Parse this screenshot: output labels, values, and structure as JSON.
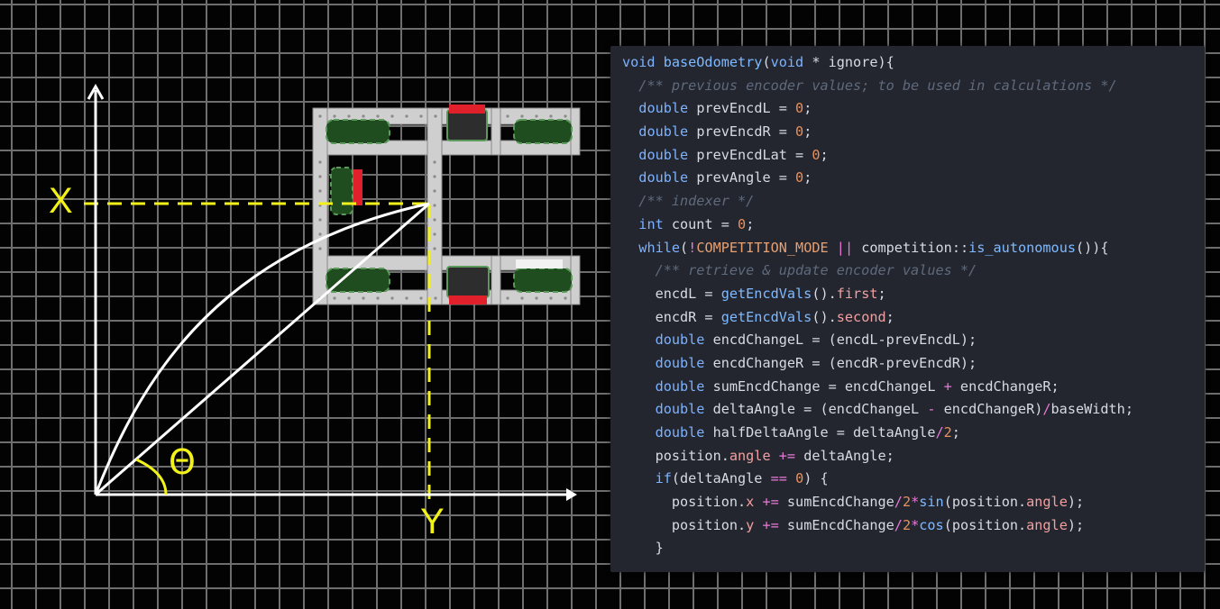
{
  "diagram": {
    "label_x": "X",
    "label_y": "Y",
    "label_theta": "Θ",
    "colors": {
      "axes": "#ffffff",
      "guides": "#f2f21a",
      "robot_frame": "#c9c9c9",
      "wheel": "#2f6a2f",
      "accent": "#e0202a"
    }
  },
  "code": {
    "lines": [
      [
        [
          "kw",
          "void "
        ],
        [
          "fn",
          "baseOdometry"
        ],
        [
          "plain",
          "("
        ],
        [
          "kw",
          "void"
        ],
        [
          "plain",
          " * ignore){"
        ]
      ],
      [
        [
          "plain",
          "  "
        ],
        [
          "cm",
          "/** previous encoder values; to be used in calculations */"
        ]
      ],
      [
        [
          "plain",
          "  "
        ],
        [
          "kw",
          "double "
        ],
        [
          "plain",
          "prevEncdL = "
        ],
        [
          "num",
          "0"
        ],
        [
          "plain",
          ";"
        ]
      ],
      [
        [
          "plain",
          "  "
        ],
        [
          "kw",
          "double "
        ],
        [
          "plain",
          "prevEncdR = "
        ],
        [
          "num",
          "0"
        ],
        [
          "plain",
          ";"
        ]
      ],
      [
        [
          "plain",
          "  "
        ],
        [
          "kw",
          "double "
        ],
        [
          "plain",
          "prevEncdLat = "
        ],
        [
          "num",
          "0"
        ],
        [
          "plain",
          ";"
        ]
      ],
      [
        [
          "plain",
          "  "
        ],
        [
          "kw",
          "double "
        ],
        [
          "plain",
          "prevAngle = "
        ],
        [
          "num",
          "0"
        ],
        [
          "plain",
          ";"
        ]
      ],
      [
        [
          "plain",
          "  "
        ],
        [
          "cm",
          "/** indexer */"
        ]
      ],
      [
        [
          "plain",
          "  "
        ],
        [
          "kw",
          "int "
        ],
        [
          "plain",
          "count = "
        ],
        [
          "num",
          "0"
        ],
        [
          "plain",
          ";"
        ]
      ],
      [
        [
          "plain",
          "  "
        ],
        [
          "kw",
          "while"
        ],
        [
          "plain",
          "("
        ],
        [
          "op",
          "!"
        ],
        [
          "macro",
          "COMPETITION_MODE"
        ],
        [
          "plain",
          " "
        ],
        [
          "op",
          "||"
        ],
        [
          "plain",
          " competition::"
        ],
        [
          "fn",
          "is_autonomous"
        ],
        [
          "plain",
          "()){"
        ]
      ],
      [
        [
          "plain",
          "    "
        ],
        [
          "cm",
          "/** retrieve & update encoder values */"
        ]
      ],
      [
        [
          "plain",
          "    encdL = "
        ],
        [
          "fn",
          "getEncdVals"
        ],
        [
          "plain",
          "()."
        ],
        [
          "prop",
          "first"
        ],
        [
          "plain",
          ";"
        ]
      ],
      [
        [
          "plain",
          "    encdR = "
        ],
        [
          "fn",
          "getEncdVals"
        ],
        [
          "plain",
          "()."
        ],
        [
          "prop",
          "second"
        ],
        [
          "plain",
          ";"
        ]
      ],
      [
        [
          "plain",
          "    "
        ],
        [
          "kw",
          "double "
        ],
        [
          "plain",
          "encdChangeL = (encdL-prevEncdL);"
        ]
      ],
      [
        [
          "plain",
          "    "
        ],
        [
          "kw",
          "double "
        ],
        [
          "plain",
          "encdChangeR = (encdR-prevEncdR);"
        ]
      ],
      [
        [
          "plain",
          "    "
        ],
        [
          "kw",
          "double "
        ],
        [
          "plain",
          "sumEncdChange = encdChangeL "
        ],
        [
          "op",
          "+"
        ],
        [
          "plain",
          " encdChangeR;"
        ]
      ],
      [
        [
          "plain",
          "    "
        ],
        [
          "kw",
          "double "
        ],
        [
          "plain",
          "deltaAngle = (encdChangeL "
        ],
        [
          "op",
          "-"
        ],
        [
          "plain",
          " encdChangeR)"
        ],
        [
          "op",
          "/"
        ],
        [
          "plain",
          "baseWidth;"
        ]
      ],
      [
        [
          "plain",
          "    "
        ],
        [
          "kw",
          "double "
        ],
        [
          "plain",
          "halfDeltaAngle = deltaAngle"
        ],
        [
          "op",
          "/"
        ],
        [
          "num",
          "2"
        ],
        [
          "plain",
          ";"
        ]
      ],
      [
        [
          "plain",
          "    position."
        ],
        [
          "prop",
          "angle"
        ],
        [
          "plain",
          " "
        ],
        [
          "op",
          "+="
        ],
        [
          "plain",
          " deltaAngle;"
        ]
      ],
      [
        [
          "plain",
          "    "
        ],
        [
          "kw",
          "if"
        ],
        [
          "plain",
          "(deltaAngle "
        ],
        [
          "op",
          "=="
        ],
        [
          "plain",
          " "
        ],
        [
          "num",
          "0"
        ],
        [
          "plain",
          ") {"
        ]
      ],
      [
        [
          "plain",
          "      position."
        ],
        [
          "prop",
          "x"
        ],
        [
          "plain",
          " "
        ],
        [
          "op",
          "+="
        ],
        [
          "plain",
          " sumEncdChange"
        ],
        [
          "op",
          "/"
        ],
        [
          "num",
          "2"
        ],
        [
          "op",
          "*"
        ],
        [
          "fn",
          "sin"
        ],
        [
          "plain",
          "(position."
        ],
        [
          "prop",
          "angle"
        ],
        [
          "plain",
          ");"
        ]
      ],
      [
        [
          "plain",
          "      position."
        ],
        [
          "prop",
          "y"
        ],
        [
          "plain",
          " "
        ],
        [
          "op",
          "+="
        ],
        [
          "plain",
          " sumEncdChange"
        ],
        [
          "op",
          "/"
        ],
        [
          "num",
          "2"
        ],
        [
          "op",
          "*"
        ],
        [
          "fn",
          "cos"
        ],
        [
          "plain",
          "(position."
        ],
        [
          "prop",
          "angle"
        ],
        [
          "plain",
          ");"
        ]
      ],
      [
        [
          "plain",
          "    }"
        ]
      ]
    ]
  }
}
